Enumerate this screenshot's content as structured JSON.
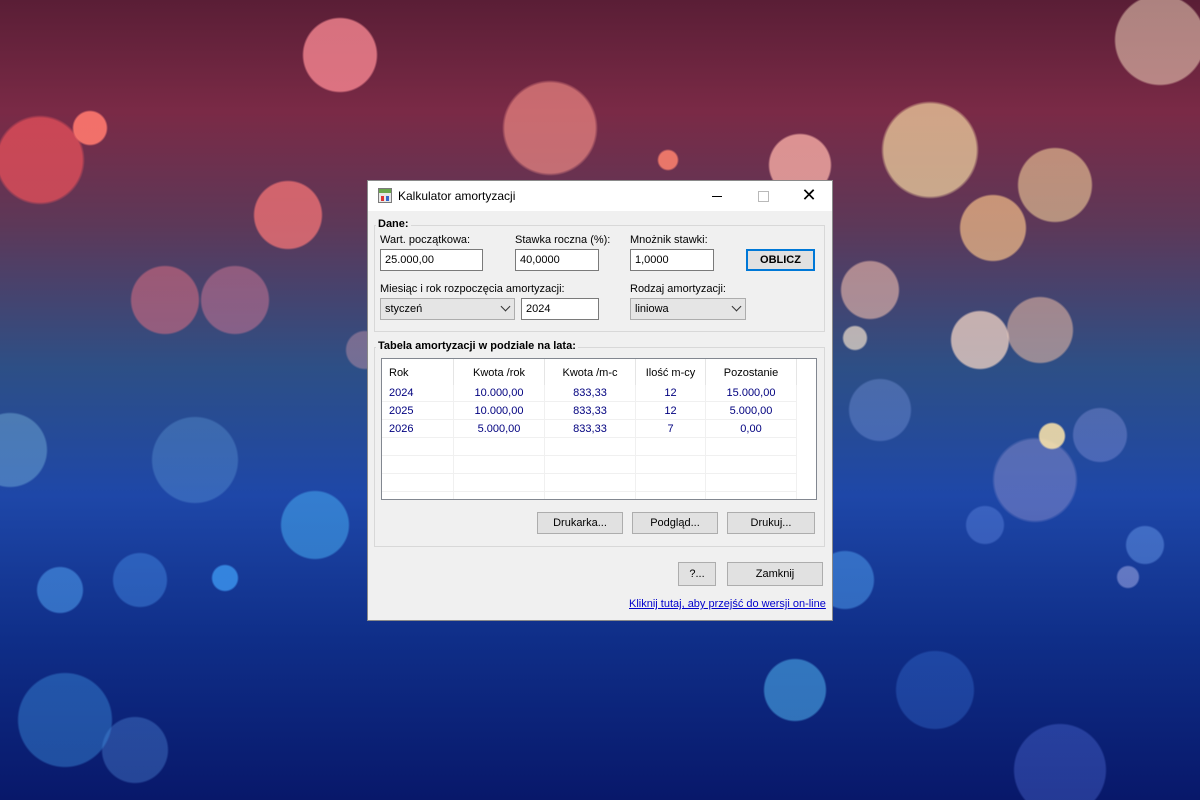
{
  "window": {
    "title": "Kalkulator amortyzacji"
  },
  "dane": {
    "group_label": "Dane:",
    "wart_label": "Wart. początkowa:",
    "wart_value": "25.000,00",
    "stawka_label": "Stawka roczna (%):",
    "stawka_value": "40,0000",
    "mnoznik_label": "Mnożnik stawki:",
    "mnoznik_value": "1,0000",
    "oblicz_label": "OBLICZ",
    "miesiac_label": "Miesiąc i rok rozpoczęcia amortyzacji:",
    "miesiac_value": "styczeń",
    "rok_value": "2024",
    "rodzaj_label": "Rodzaj amortyzacji:",
    "rodzaj_value": "liniowa"
  },
  "tabela": {
    "group_label": "Tabela amortyzacji w podziale na lata:",
    "headers": [
      "Rok",
      "Kwota /rok",
      "Kwota /m-c",
      "Ilość m-cy",
      "Pozostanie"
    ],
    "rows": [
      [
        "2024",
        "10.000,00",
        "833,33",
        "12",
        "15.000,00"
      ],
      [
        "2025",
        "10.000,00",
        "833,33",
        "12",
        "5.000,00"
      ],
      [
        "2026",
        "5.000,00",
        "833,33",
        "7",
        "0,00"
      ]
    ],
    "drukarka_label": "Drukarka...",
    "podglad_label": "Podgląd...",
    "drukuj_label": "Drukuj..."
  },
  "footer": {
    "help_label": "?...",
    "zamknij_label": "Zamknij",
    "link_text": "Kliknij tutaj, aby przejść do wersji on-line"
  },
  "icons": {
    "app": "calculator-icon",
    "minimize": "minimize-icon",
    "maximize": "maximize-icon",
    "close": "close-icon",
    "dropdown": "chevron-down-icon"
  }
}
